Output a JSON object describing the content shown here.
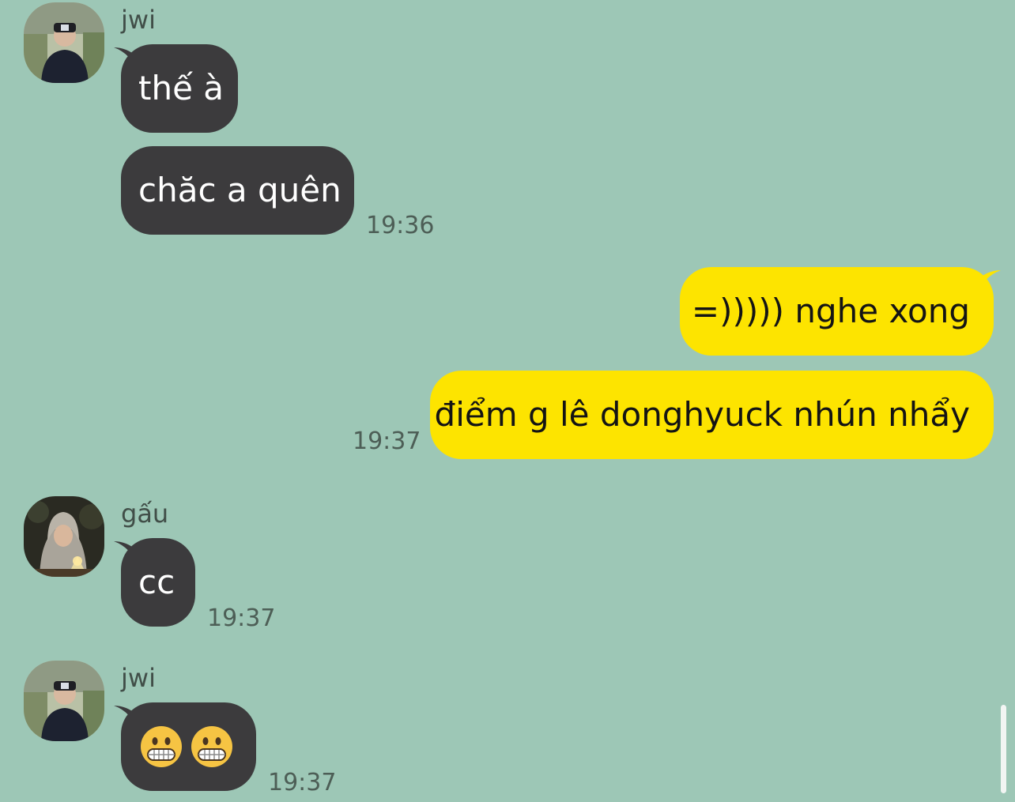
{
  "chat": {
    "messages": [
      {
        "sender": "jwi",
        "avatar_icon": "profile-photo-jwi",
        "bubbles": [
          "thế à",
          "chăc a quên"
        ],
        "time": "19:36"
      },
      {
        "sender": "me",
        "bubbles": [
          "=))))) nghe xong",
          "điểm g lê donghyuck nhún nhẩy"
        ],
        "time": "19:37"
      },
      {
        "sender": "gấu",
        "avatar_icon": "profile-photo-gau",
        "bubbles": [
          "cc"
        ],
        "time": "19:37"
      },
      {
        "sender": "jwi",
        "avatar_icon": "profile-photo-jwi",
        "bubbles": [
          "😬😬"
        ],
        "time": "19:37"
      }
    ]
  },
  "colors": {
    "background": "#9dc7b6",
    "incoming_bubble": "#3c3b3d",
    "outgoing_bubble": "#fde400",
    "scrollbar": "#f2f5f3"
  }
}
